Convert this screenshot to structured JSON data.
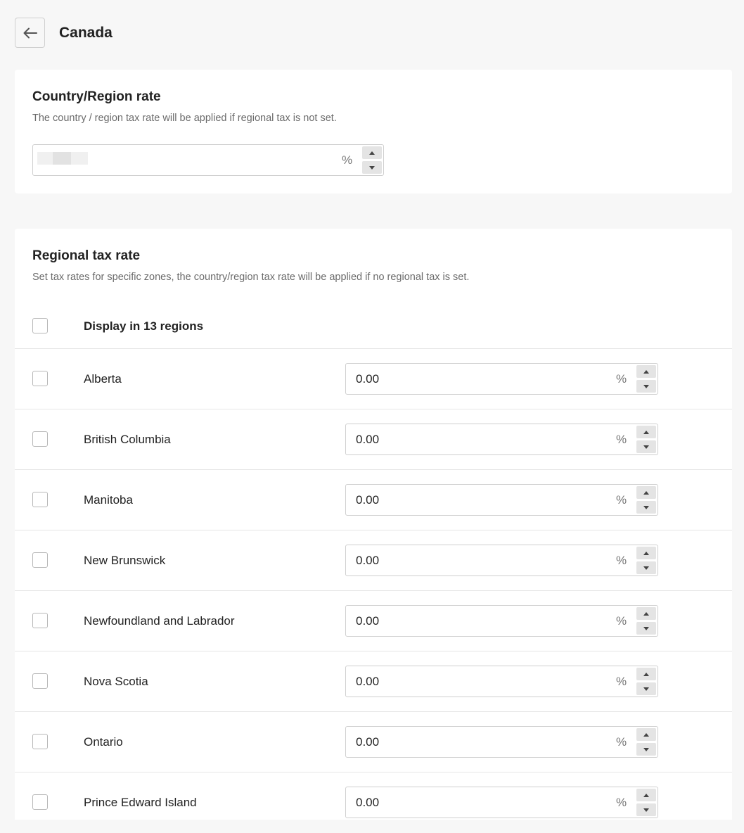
{
  "header": {
    "title": "Canada"
  },
  "country_rate": {
    "title": "Country/Region rate",
    "description": "The country / region tax rate will be applied if regional tax is not set.",
    "value": "",
    "unit": "%"
  },
  "regional": {
    "title": "Regional tax rate",
    "description": "Set tax rates for specific zones, the country/region tax rate will be applied if no regional tax is set.",
    "select_all_label": "Display in 13 regions",
    "unit": "%",
    "regions": [
      {
        "name": "Alberta",
        "value": "0.00"
      },
      {
        "name": "British Columbia",
        "value": "0.00"
      },
      {
        "name": "Manitoba",
        "value": "0.00"
      },
      {
        "name": "New Brunswick",
        "value": "0.00"
      },
      {
        "name": "Newfoundland and Labrador",
        "value": "0.00"
      },
      {
        "name": "Nova Scotia",
        "value": "0.00"
      },
      {
        "name": "Ontario",
        "value": "0.00"
      },
      {
        "name": "Prince Edward Island",
        "value": "0.00"
      }
    ]
  },
  "icons": {
    "back": "arrow-left-icon",
    "step_up": "triangle-up-icon",
    "step_down": "triangle-down-icon"
  }
}
